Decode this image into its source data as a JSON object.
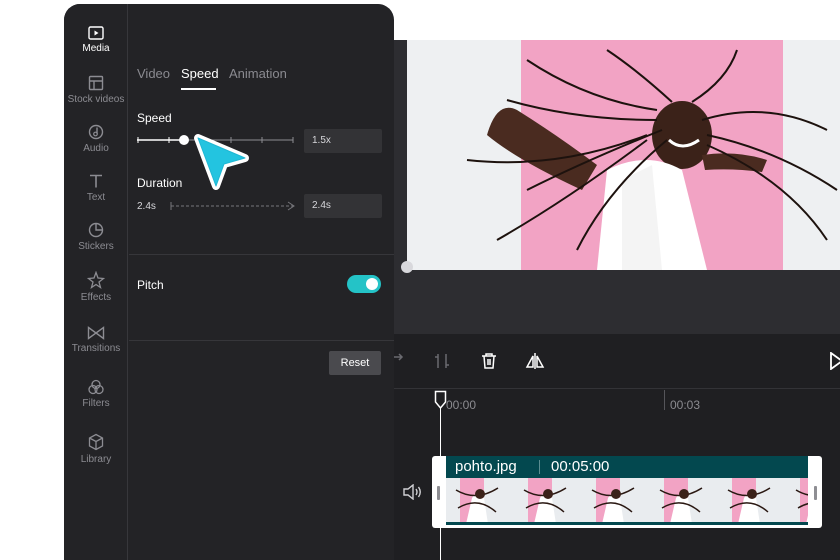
{
  "sidebar": {
    "items": [
      {
        "label": "Media",
        "icon": "media-icon",
        "active": true
      },
      {
        "label": "Stock videos",
        "icon": "stock-videos-icon"
      },
      {
        "label": "Audio",
        "icon": "audio-icon"
      },
      {
        "label": "Text",
        "icon": "text-icon"
      },
      {
        "label": "Stickers",
        "icon": "stickers-icon"
      },
      {
        "label": "Effects",
        "icon": "effects-icon"
      },
      {
        "label": "Transitions",
        "icon": "transitions-icon"
      },
      {
        "label": "Filters",
        "icon": "filters-icon"
      },
      {
        "label": "Library",
        "icon": "library-icon"
      }
    ]
  },
  "tabs": [
    {
      "label": "Video",
      "active": false
    },
    {
      "label": "Speed",
      "active": true
    },
    {
      "label": "Animation",
      "active": false
    }
  ],
  "speed": {
    "label": "Speed",
    "value": "1.5x",
    "slider_level": 0.3
  },
  "duration": {
    "label": "Duration",
    "from": "2.4s",
    "to": "2.4s"
  },
  "pitch": {
    "label": "Pitch",
    "enabled": true
  },
  "reset_label": "Reset",
  "timeline": {
    "time_marks": [
      "00:00",
      "00:03"
    ],
    "clip": {
      "name": "pohto.jpg",
      "duration": "00:05:00"
    }
  },
  "colors": {
    "accent": "#24c3c7",
    "panel_bg": "#232326",
    "clip_header": "#03484f",
    "photo_pink": "#f2a3c4"
  }
}
